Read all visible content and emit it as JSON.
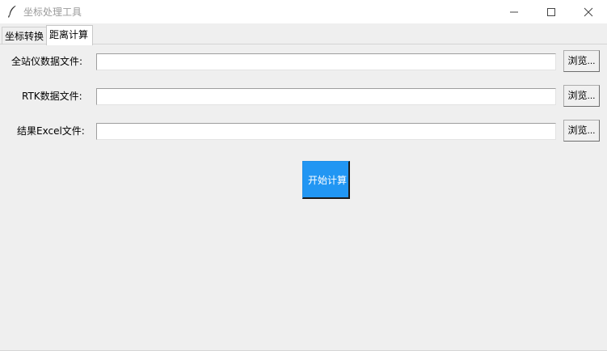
{
  "window": {
    "title": "坐标处理工具",
    "app_icon": "feather-icon"
  },
  "tabs": [
    {
      "label": "坐标转换",
      "selected": false
    },
    {
      "label": "距离计算",
      "selected": true
    }
  ],
  "form": {
    "fields": [
      {
        "label": "全站仪数据文件:",
        "value": "",
        "browse_label": "浏览..."
      },
      {
        "label": "RTK数据文件:",
        "value": "",
        "browse_label": "浏览..."
      },
      {
        "label": "结果Excel文件:",
        "value": "",
        "browse_label": "浏览..."
      }
    ],
    "start_label": "开始计算"
  },
  "colors": {
    "background": "#efefef",
    "accent_button": "#2196f3",
    "title_text": "#9a9a9a"
  }
}
